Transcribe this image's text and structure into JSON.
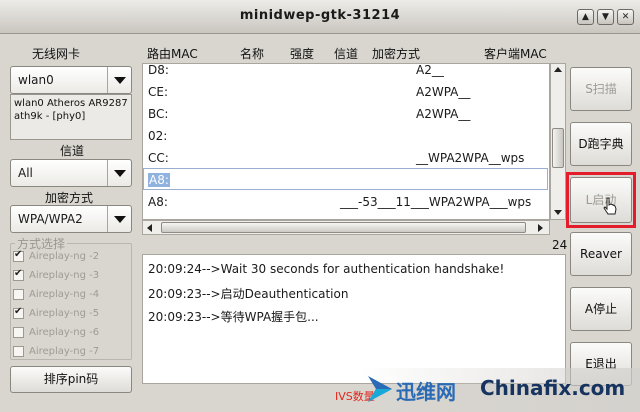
{
  "window": {
    "title": "minidwep-gtk-31214"
  },
  "left": {
    "wireless_card_label": "无线网卡",
    "interface_value": "wlan0",
    "interface_info": [
      "wlan0 Atheros AR9287",
      "ath9k - [phy0]"
    ],
    "channel_label": "信道",
    "channel_value": "All",
    "encryption_label": "加密方式",
    "encryption_value": "WPA/WPA2",
    "method_group_title": "方式选择",
    "methods": [
      {
        "label": "Aireplay-ng -2",
        "checked": true
      },
      {
        "label": "Aireplay-ng -3",
        "checked": true
      },
      {
        "label": "Aireplay-ng -4",
        "checked": false
      },
      {
        "label": "Aireplay-ng -5",
        "checked": true
      },
      {
        "label": "Aireplay-ng -6",
        "checked": false
      },
      {
        "label": "Aireplay-ng -7",
        "checked": false
      }
    ],
    "pin_sort_button": "排序pin码"
  },
  "table": {
    "headers": [
      "路由MAC",
      "名称",
      "强度",
      "信道",
      "加密方式",
      "客户端MAC"
    ],
    "rows": [
      {
        "mac": "D8:",
        "detail": "A2__"
      },
      {
        "mac": "CE:",
        "detail": "A2WPA__"
      },
      {
        "mac": "BC:",
        "detail": "A2WPA__"
      },
      {
        "mac": "02:",
        "detail": ""
      },
      {
        "mac": "CC:",
        "detail": "__WPA2WPA__wps"
      },
      {
        "mac": "A8:",
        "detail": ""
      },
      {
        "mac": "A8:",
        "detail": "___-53___11___WPA2WPA___wps"
      }
    ],
    "selected_row": 5
  },
  "count_text": "24",
  "log": {
    "lines": [
      "20:09:24-->Wait 30 seconds for authentication handshake!",
      "20:09:23-->启动Deauthentication",
      "20:09:23-->等待WPA握手包..."
    ]
  },
  "buttons": {
    "scan": "S扫描",
    "dictionary": "D跑字典",
    "start": "L启动",
    "reaver": "Reaver",
    "stop": "A停止",
    "exit": "E退出"
  },
  "status": {
    "ivs": "IVS数量"
  },
  "watermark": {
    "brand_cn": "迅维网",
    "brand_en": "Chinafix.com"
  },
  "colors": {
    "highlight": "#e41c2b",
    "selection": "#8fb2de",
    "ivs_text": "#e0261b"
  }
}
